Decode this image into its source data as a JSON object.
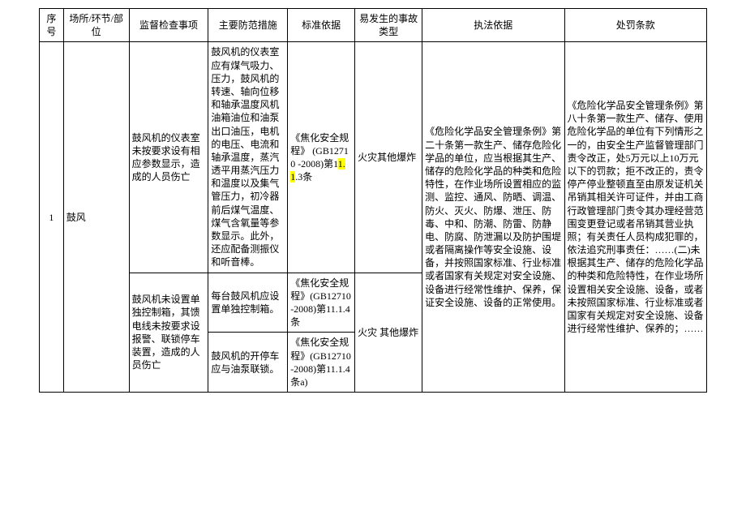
{
  "headers": {
    "seq": "序号",
    "location": "场所/环节/部位",
    "inspection": "监督检查事项",
    "measures": "主要防范措施",
    "standard": "标准依据",
    "accident": "易发生的事故类型",
    "lawbasis": "执法依据",
    "penalty": "处罚条款"
  },
  "row": {
    "seq": "1",
    "location": "鼓风",
    "insp1": "鼓风机的仪表室未按要求设有相应参数显示，造成的人员伤亡",
    "meas1": "鼓风机的仪表室应有煤气吸力、压力，鼓风机的转速、轴向位移和轴承温度风机油箱油位和油泵出口油压，电机的电压、电流和轴承温度，蒸汽透平用蒸汽压力和温度以及集气管压力，初冷器前后煤气温度、煤气含氧量等参数显示。此外，还应配备测振仪和听音棒。",
    "std1a": "《焦化安全规程》 (GB12710 -2008)第1",
    "std1b": "1.1",
    "std1c": ".3条",
    "acc1": "火灾其他爆炸",
    "insp2": "鼓风机未设置单独控制箱，其馈电线未按要求设报警、联锁停车装置，造成的人员伤亡",
    "meas2a": "每台鼓风机应设置单独控制箱。",
    "std2a": "《焦化安全规程》(GB12710 -2008)第11.1.4条",
    "meas2b": "鼓风机的开停车应与油泵联锁。",
    "std2b": "《焦化安全规程》(GB12710 -2008)第11.1.4条a)",
    "acc2": "火灾 其他爆炸",
    "lawbasis": "《危险化学品安全管理条例》第二十条第一款生产、储存危险化学品的单位，应当根据其生产、储存的危险化学品的种类和危险特性，在作业场所设置相应的监测、监控、通风、防晒、调温、防火、灭火、防爆、泄压、防毒、中和、防潮、防雷、防静电、防腐、防泄漏以及防护围堤或者隔离操作等安全设施、设备，并按照国家标准、行业标准或者国家有关规定对安全设施、设备进行经常性维护、保养，保证安全设施、设备的正常使用。",
    "penalty": "《危险化学品安全管理条例》第八十条第一款生产、储存、使用危险化学品的单位有下列情形之一的，由安全生产监督管理部门责令改正，处5万元以上10万元以下的罚款；拒不改正的，责令停产停业整顿直至由原发证机关吊销其相关许可证件，并由工商行政管理部门责令其办理经营范围变更登记或者吊销其营业执照；有关责任人员构成犯罪的，依法追究刑事责任：……(二)未根据其生产、储存的危险化学品的种类和危险特性，在作业场所设置相关安全设施、设备，或者未按照国家标准、行业标准或者国家有关规定对安全设施、设备进行经常性维护、保养的；……"
  }
}
